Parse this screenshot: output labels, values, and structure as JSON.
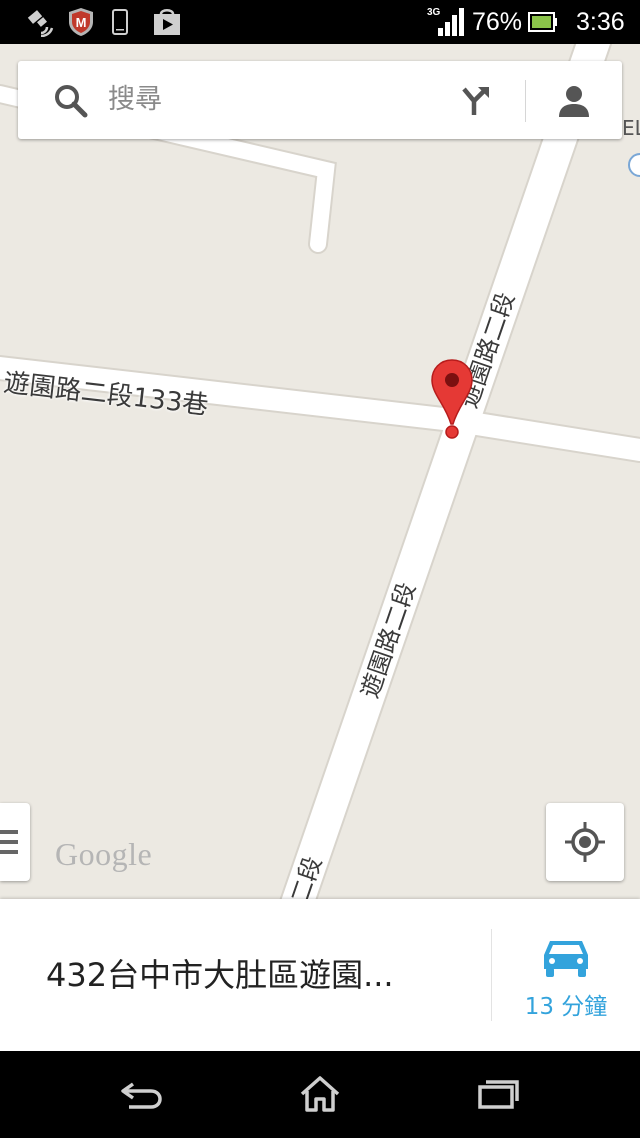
{
  "status_bar": {
    "network_type": "3G",
    "battery_percent": "76%",
    "time": "3:36",
    "icons": [
      "gps-icon",
      "mcafee-icon",
      "phone-icon",
      "play-store-icon",
      "signal-icon",
      "battery-icon"
    ]
  },
  "search": {
    "placeholder": "搜尋",
    "icons": [
      "search-icon",
      "directions-icon",
      "account-icon"
    ]
  },
  "map": {
    "street_labels": {
      "lane_133": "遊園路二段133巷",
      "main_upper": "遊園路二段",
      "main_lower": "遊園路二段",
      "main_bottom": "二段"
    },
    "edge_label": "EL",
    "logo": "Google",
    "pin_color": "#e53935"
  },
  "bottom_card": {
    "address": "432台中市大肚區遊園...",
    "eta": "13 分鐘",
    "eta_icon": "car-icon",
    "accent_color": "#33a3dc"
  },
  "nav_bar": {
    "icons": [
      "back-icon",
      "home-icon",
      "recent-apps-icon"
    ]
  }
}
